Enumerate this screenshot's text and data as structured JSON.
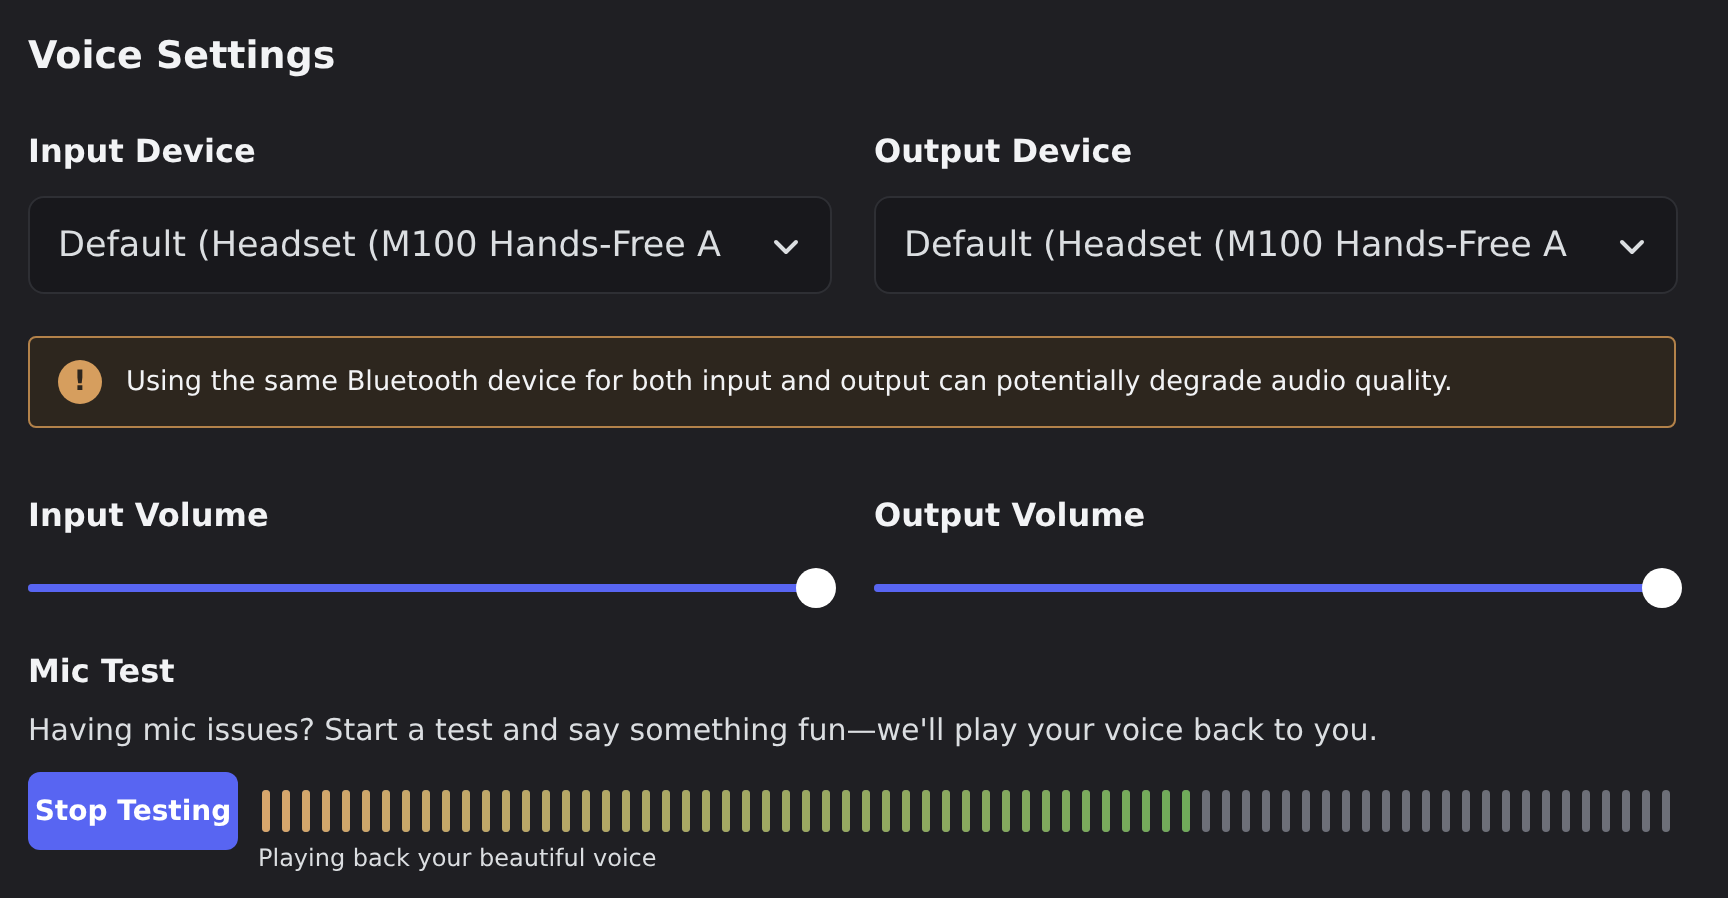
{
  "title": "Voice Settings",
  "devices": [
    {
      "label": "Input Device",
      "value": "Default (Headset (M100 Hands-Free A"
    },
    {
      "label": "Output Device",
      "value": "Default (Headset (M100 Hands-Free A"
    }
  ],
  "warning": {
    "icon": "!",
    "text": "Using the same Bluetooth device for both input and output can potentially degrade audio quality."
  },
  "volumes": [
    {
      "label": "Input Volume",
      "level": 1
    },
    {
      "label": "Output Volume",
      "level": 1
    }
  ],
  "mic_test": {
    "heading": "Mic Test",
    "description": "Having mic issues? Start a test and say something fun—we'll play your voice back to you.",
    "button": "Stop Testing",
    "caption": "Playing back your beautiful voice"
  }
}
